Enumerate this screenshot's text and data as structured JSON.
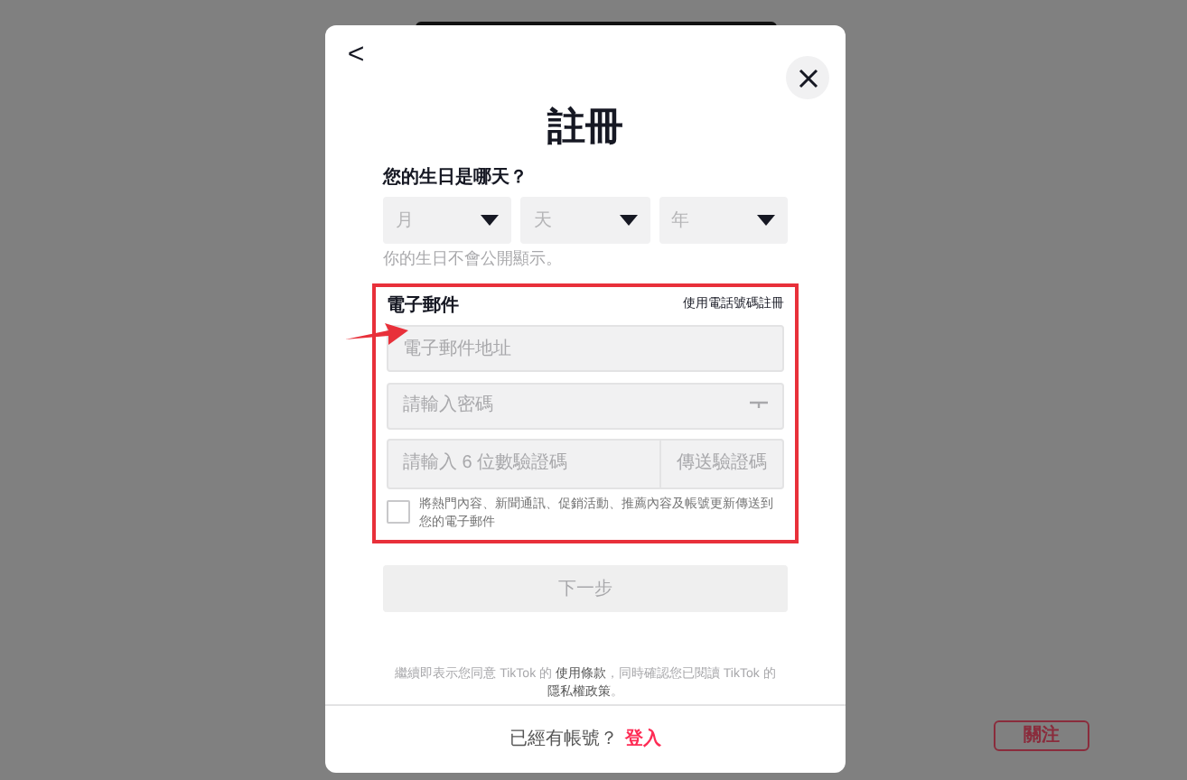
{
  "background": {
    "follow_button": "關注"
  },
  "dialog": {
    "back": "<",
    "title": "註冊",
    "birthday": {
      "label": "您的生日是哪天？",
      "selects": [
        {
          "placeholder": "月"
        },
        {
          "placeholder": "天"
        },
        {
          "placeholder": "年"
        }
      ],
      "hint": "你的生日不會公開顯示。"
    },
    "email_section": {
      "label": "電子郵件",
      "switch_link": "使用電話號碼註冊",
      "highlighted": true,
      "email": {
        "placeholder": "電子郵件地址"
      },
      "password": {
        "placeholder": "請輸入密碼"
      },
      "code": {
        "placeholder": "請輸入 6 位數驗證碼",
        "button": "傳送驗證碼"
      },
      "consent": {
        "checked": false,
        "text": "將熱門內容、新聞通訊、促銷活動、推薦內容及帳號更新傳送到您的電子郵件"
      }
    },
    "next_button": {
      "label": "下一步",
      "disabled": true
    },
    "terms": {
      "prefix": "繼續即表示您同意 TikTok 的 ",
      "terms_link": "使用條款",
      "middle": "，同時確認您已閱讀 TikTok 的 ",
      "privacy_link": "隱私權政策",
      "suffix": "。"
    },
    "footer": {
      "text": "已經有帳號？",
      "login_link": "登入"
    }
  }
}
